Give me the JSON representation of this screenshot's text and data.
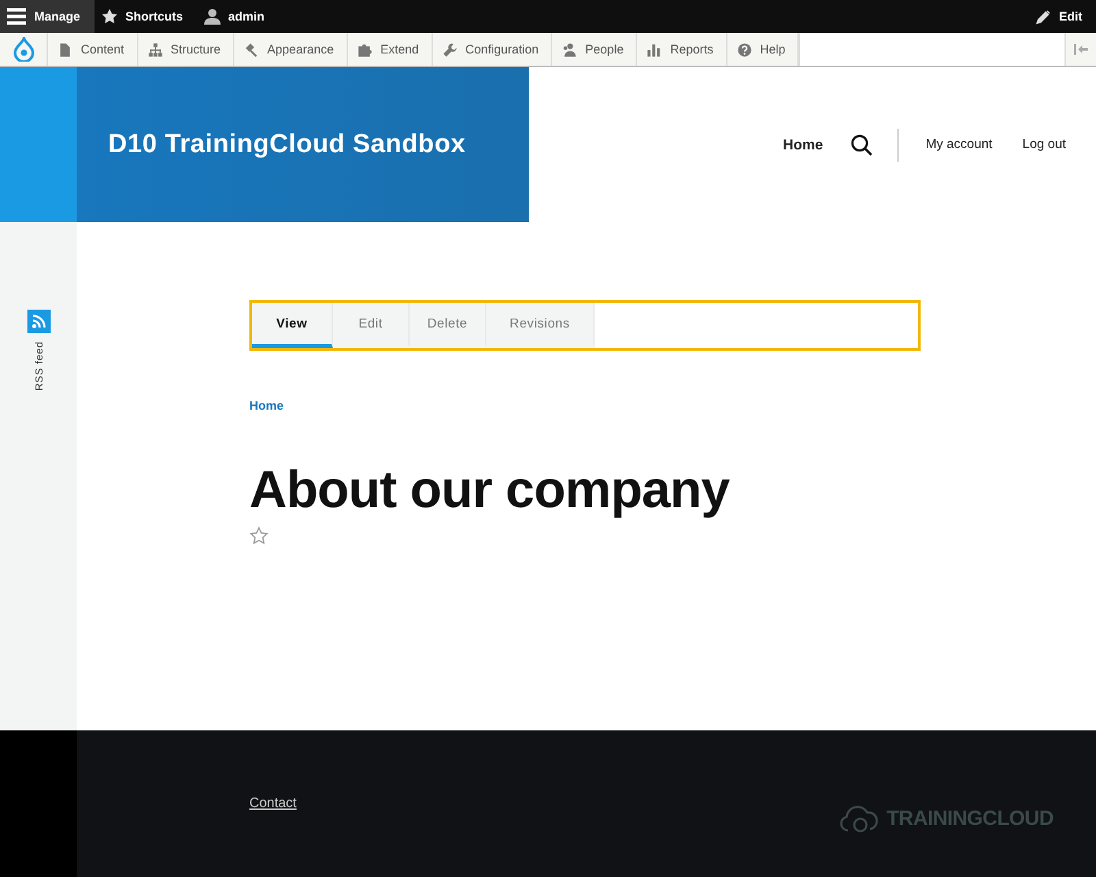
{
  "admin_toolbar": {
    "items": [
      {
        "label": "Manage",
        "selected": true
      },
      {
        "label": "Shortcuts",
        "selected": false
      },
      {
        "label": "admin",
        "selected": false
      }
    ],
    "edit": "Edit"
  },
  "admin_tray": {
    "items": [
      {
        "label": "Content",
        "kind": "page"
      },
      {
        "label": "Structure",
        "kind": "tree"
      },
      {
        "label": "Appearance",
        "kind": "brush"
      },
      {
        "label": "Extend",
        "kind": "puzzle"
      },
      {
        "label": "Configuration",
        "kind": "wrench"
      },
      {
        "label": "People",
        "kind": "people"
      },
      {
        "label": "Reports",
        "kind": "bars"
      },
      {
        "label": "Help",
        "kind": "help"
      }
    ]
  },
  "header": {
    "site_name": "D10 TrainingCloud Sandbox",
    "nav": [
      {
        "label": "Home",
        "selected": true
      },
      {
        "label": "My account",
        "selected": false
      },
      {
        "label": "Log out",
        "selected": false
      }
    ]
  },
  "sidebar": {
    "rss": "RSS feed"
  },
  "tabs": [
    {
      "label": "View",
      "selected": true
    },
    {
      "label": "Edit",
      "selected": false
    },
    {
      "label": "Delete",
      "selected": false
    },
    {
      "label": "Revisions",
      "selected": false
    }
  ],
  "breadcrumb": [
    "Home"
  ],
  "page_title": "About our company",
  "footer": {
    "links": [
      "Contact"
    ],
    "logo_text": "TRAININGCLOUD"
  }
}
